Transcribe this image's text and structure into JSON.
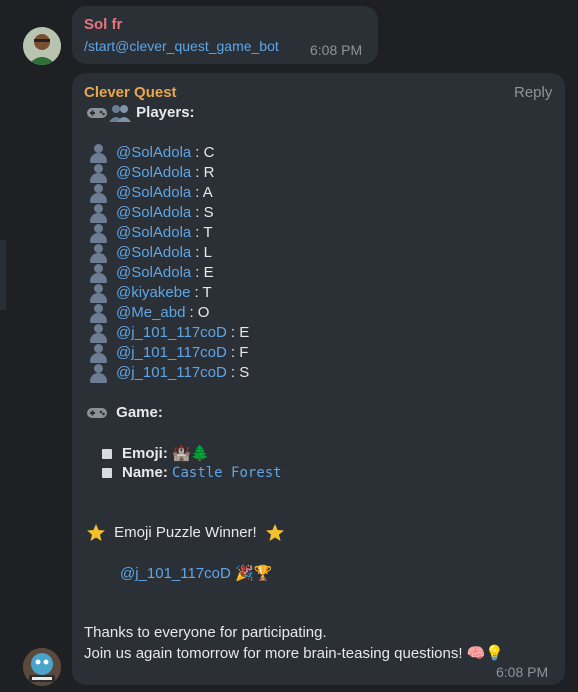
{
  "message1": {
    "sender": "Sol fr",
    "sender_color": "#e8747c",
    "text": "/start@clever_quest_game_bot",
    "time": "6:08 PM"
  },
  "message2": {
    "sender": "Clever Quest",
    "sender_color": "#e5a64e",
    "reply_label": "Reply",
    "players_title": "Players:",
    "players": [
      {
        "user": "@SolAdola",
        "letter": ": C"
      },
      {
        "user": "@SolAdola",
        "letter": ": R"
      },
      {
        "user": "@SolAdola",
        "letter": ": A"
      },
      {
        "user": "@SolAdola",
        "letter": ": S"
      },
      {
        "user": "@SolAdola",
        "letter": ": T"
      },
      {
        "user": "@SolAdola",
        "letter": ": L"
      },
      {
        "user": "@SolAdola",
        "letter": ": E"
      },
      {
        "user": "@kiyakebe",
        "letter": ": T"
      },
      {
        "user": "@Me_abd",
        "letter": ": O"
      },
      {
        "user": "@j_101_117coD",
        "letter": ": E"
      },
      {
        "user": "@j_101_117coD",
        "letter": ": F"
      },
      {
        "user": "@j_101_117coD",
        "letter": ": S"
      }
    ],
    "game_title": "Game:",
    "emoji_label": "Emoji:",
    "emoji_value": "🏰🌲",
    "name_label": "Name:",
    "name_value": "Castle Forest",
    "winner_title": "Emoji Puzzle Winner!",
    "winner_user": "@j_101_117coD",
    "winner_emojis": "🎉🏆",
    "thanks_line": "Thanks to everyone for participating.",
    "join_line": "Join us again tomorrow for more brain-teasing questions!",
    "join_emojis": "🧠💡",
    "time": "6:08 PM"
  },
  "icons": {
    "players": "gamepad-and-users-icon",
    "game": "gamepad-icon",
    "star": "glowing-star-icon"
  }
}
